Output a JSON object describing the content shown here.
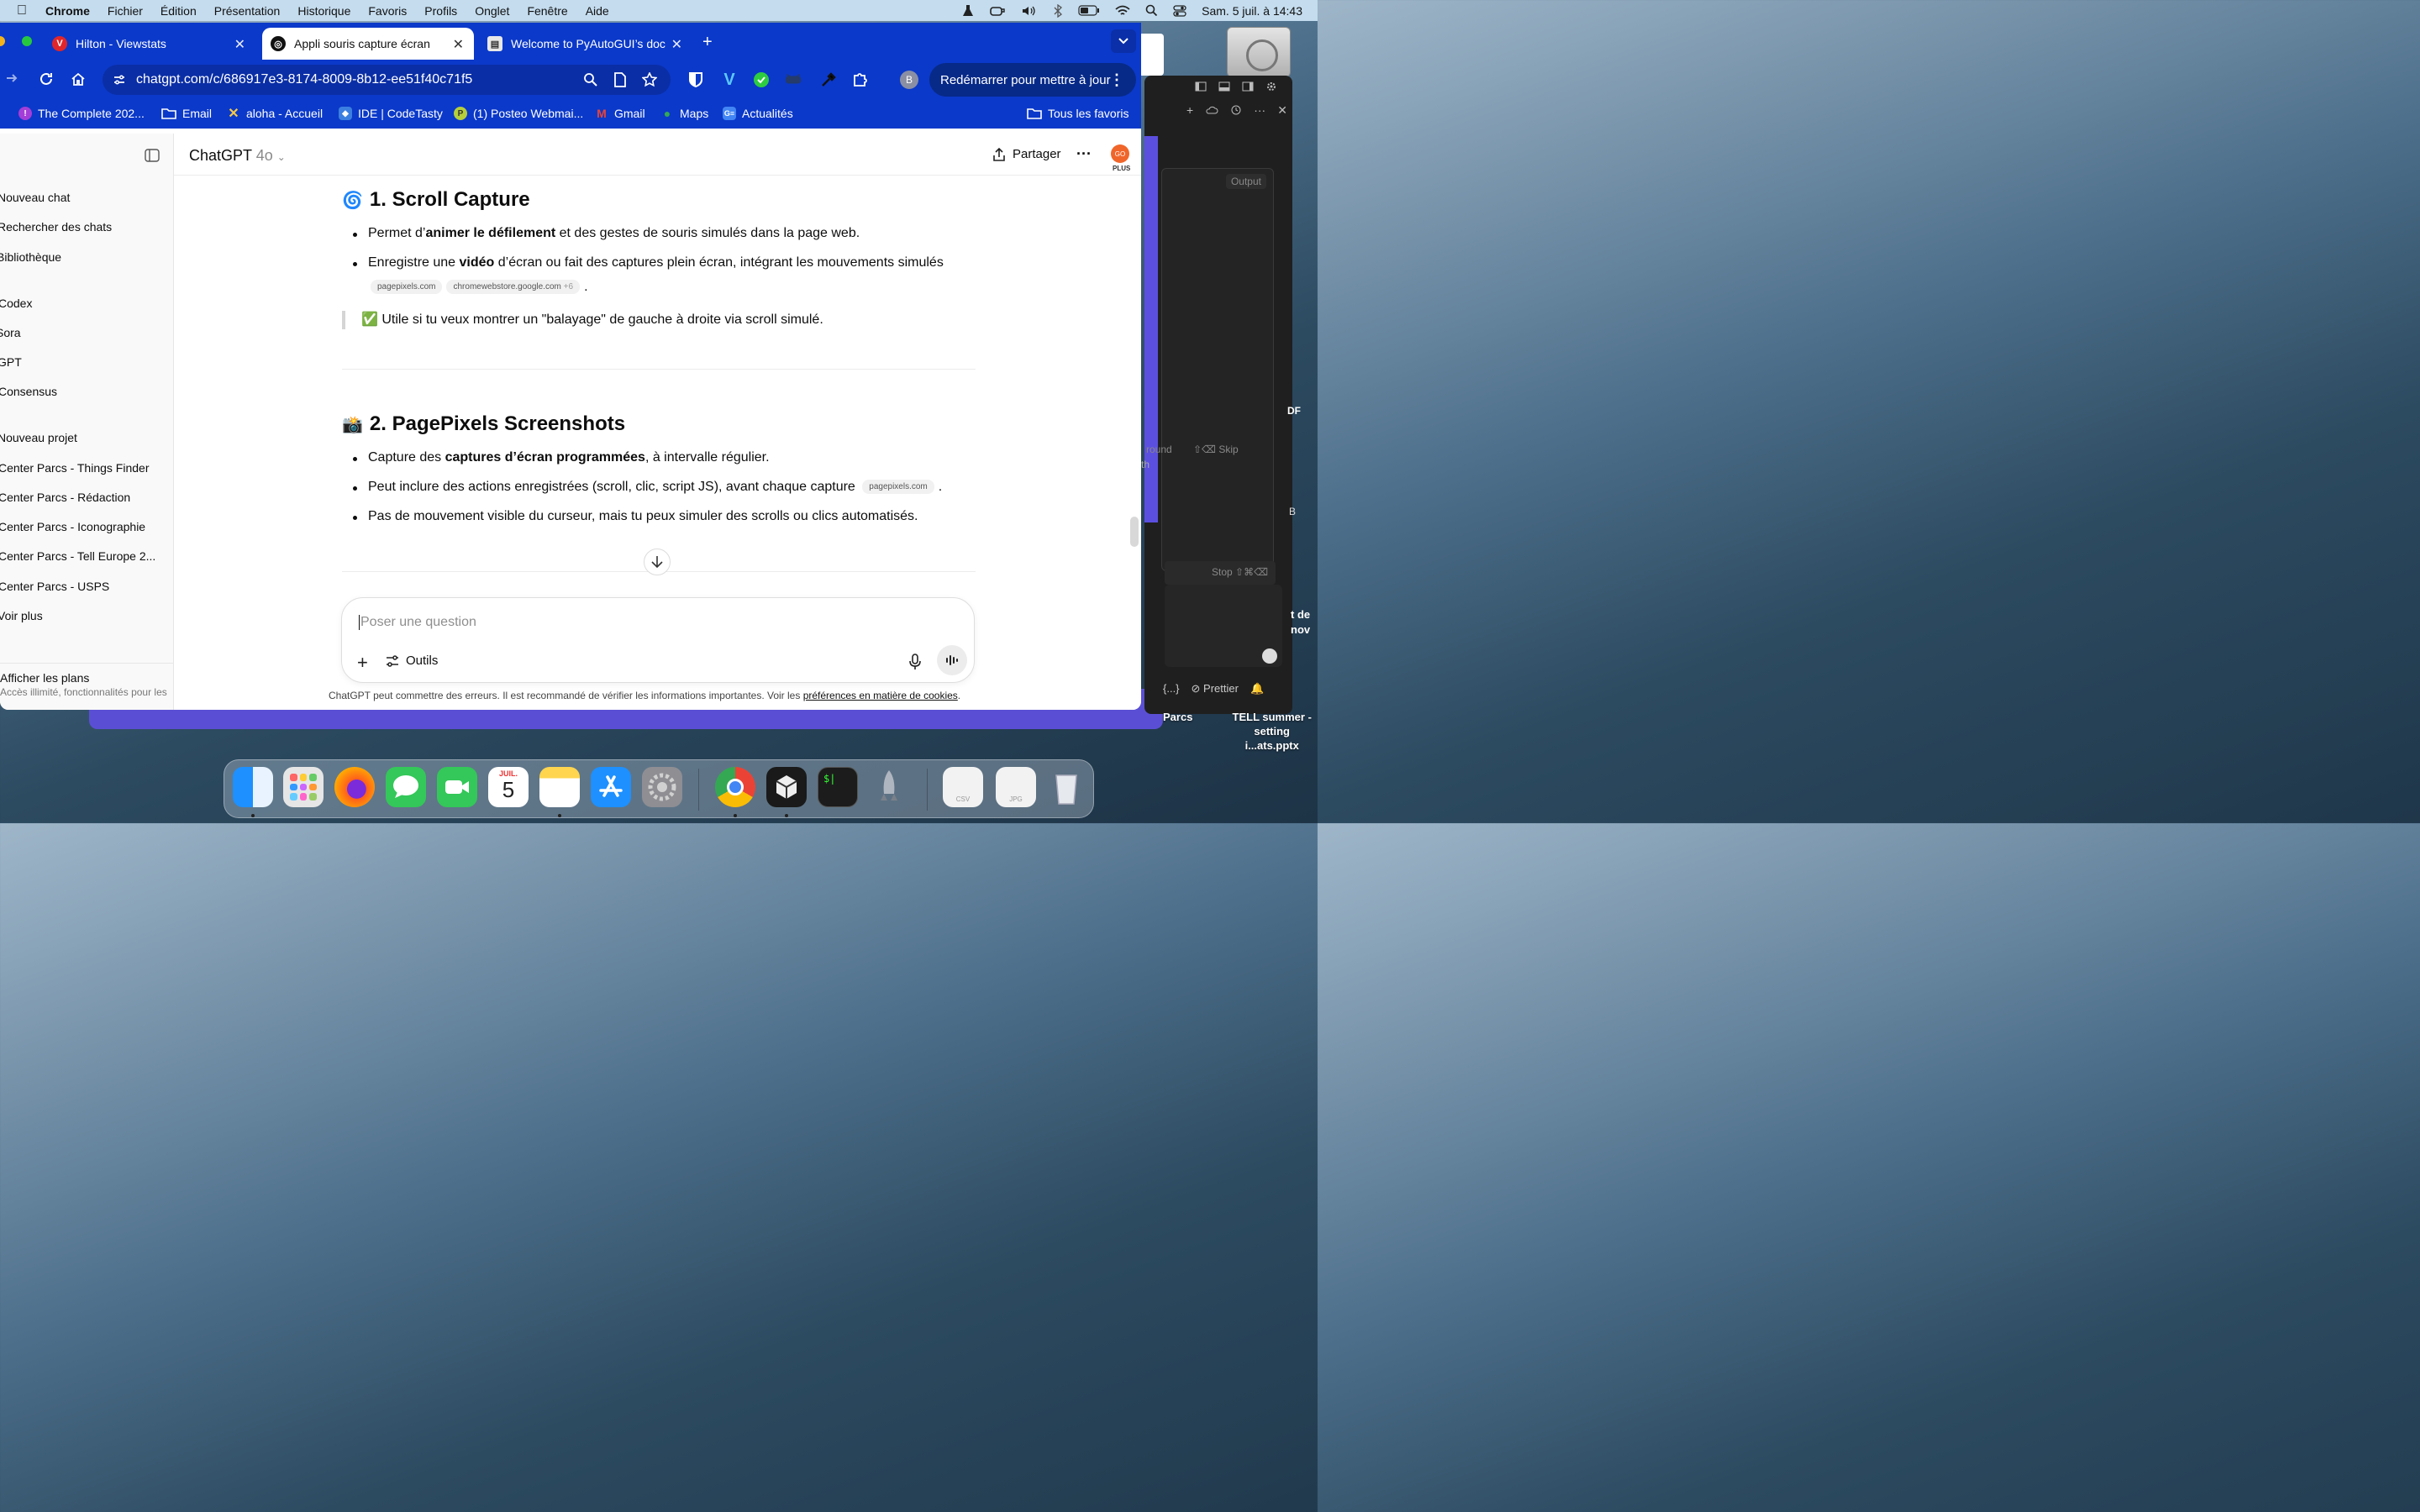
{
  "menubar": {
    "app": "Chrome",
    "items": [
      "Fichier",
      "Édition",
      "Présentation",
      "Historique",
      "Favoris",
      "Profils",
      "Onglet",
      "Fenêtre",
      "Aide"
    ],
    "clock": "Sam. 5 juil. à  14:43"
  },
  "tabs": [
    {
      "title": "Hilton - Viewstats",
      "favicon_color": "#e0262b"
    },
    {
      "title": "Appli souris capture écran",
      "favicon_color": "#111111"
    },
    {
      "title": "Welcome to PyAutoGUI’s doc",
      "favicon_color": "#4a4a4a"
    }
  ],
  "omnibox": {
    "url": "chatgpt.com/c/686917e3-8174-8009-8b12-ee51f40c71f5"
  },
  "profile_initial": "B",
  "update_button": "Redémarrer pour mettre à jour",
  "bookmarks": [
    {
      "label": "The Complete 202...",
      "color": "#a43ed8"
    },
    {
      "label": "Email",
      "color": "folder"
    },
    {
      "label": "aloha - Accueil",
      "color": "#e94b8a"
    },
    {
      "label": "IDE | CodeTasty",
      "color": "#3b7fe0"
    },
    {
      "label": "(1) Posteo Webmai...",
      "color": "#b6cf3a"
    },
    {
      "label": "Gmail",
      "color": "#ea4335"
    },
    {
      "label": "Maps",
      "color": "#34a853"
    },
    {
      "label": "Actualités",
      "color": "#4285f4"
    }
  ],
  "all_bookmarks": "Tous les favoris",
  "sidebar": {
    "items": [
      {
        "label": "Nouveau chat"
      },
      {
        "label": "Rechercher des chats"
      },
      {
        "label": "Bibliothèque"
      },
      {
        "label": "Codex"
      },
      {
        "label": "Sora"
      },
      {
        "label": "GPT"
      },
      {
        "label": "Consensus"
      },
      {
        "label": "Nouveau projet"
      },
      {
        "label": "Center Parcs - Things Finder"
      },
      {
        "label": "Center Parcs - Rédaction"
      },
      {
        "label": "Center Parcs - Iconographie"
      },
      {
        "label": "Center Parcs - Tell Europe 2..."
      },
      {
        "label": "Center Parcs - USPS"
      },
      {
        "label": "Voir plus"
      }
    ],
    "plans_title": "Afficher les plans",
    "plans_sub": "Accès illimité, fonctionnalités pour les"
  },
  "header": {
    "model": "ChatGPT",
    "version": "4o",
    "share": "Partager",
    "avatar_text": "GO",
    "plan_label": "PLUS"
  },
  "content": {
    "section1": {
      "emoji": "🌀",
      "title": "1. Scroll Capture",
      "b1_pre": "Permet d’",
      "b1_bold": "animer le défilement",
      "b1_post": " et des gestes de souris simulés dans la page web.",
      "b2_pre": "Enregistre une ",
      "b2_bold": "vidéo",
      "b2_post": " d’écran ou fait des captures plein écran, intégrant les mouvements simulés",
      "chip1": "pagepixels.com",
      "chip2": "chromewebstore.google.com",
      "chip2_more": "+6",
      "dot": ".",
      "quote": "✅ Utile si tu veux montrer un \"balayage\" de gauche à droite via scroll simulé."
    },
    "section2": {
      "emoji": "📸",
      "title": "2. PagePixels Screenshots",
      "b1_pre": "Capture des ",
      "b1_bold": "captures d’écran programmées",
      "b1_post": ", à intervalle régulier.",
      "b2": "Peut inclure des actions enregistrées (scroll, clic, script JS), avant chaque capture",
      "b2_chip": "pagepixels.com",
      "dot": ".",
      "b3": "Pas de mouvement visible du curseur, mais tu peux simuler des scrolls ou clics automatisés."
    }
  },
  "composer": {
    "placeholder": "Poser une question",
    "tools": "Outils"
  },
  "disclaimer": {
    "text": "ChatGPT peut commettre des erreurs. Il est recommandé de vérifier les informations importantes. Voir les ",
    "link": "préférences en matière de cookies",
    "end": "."
  },
  "vscode": {
    "output": "Output",
    "round": "round",
    "skip": "⇧⌫ Skip",
    "stop": "Stop ⇧⌘⌫",
    "status_braces": "{...}",
    "prettier": "Prettier",
    "edge_text": [
      "DF",
      "th",
      "B",
      "t de",
      "nov"
    ]
  },
  "desktop": {
    "files": [
      "Parcs",
      "TELL summer -\nsetting i...ats.pptx"
    ]
  },
  "dock": {
    "calendar_month": "JUIL.",
    "calendar_day": "5",
    "csv": "CSV",
    "jpg": "JPG"
  }
}
